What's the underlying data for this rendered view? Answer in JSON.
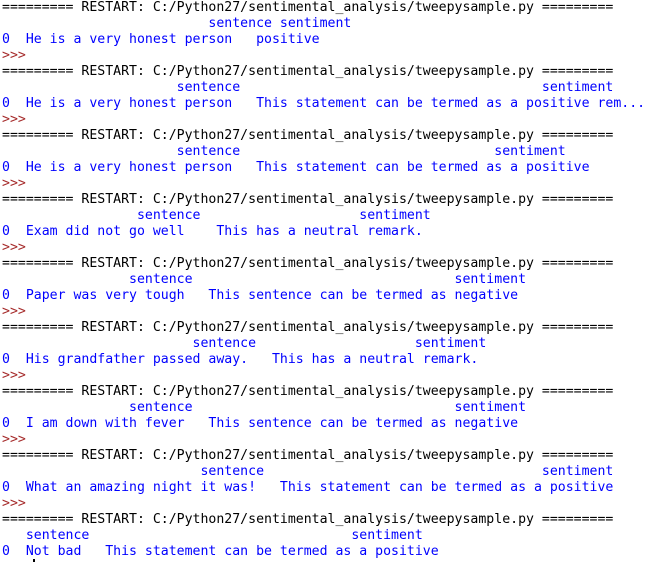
{
  "shell": {
    "colors": {
      "restart": "#000000",
      "output": "#0000ff",
      "prompt": "#a52a2a",
      "background": "#ffffff"
    },
    "lines": [
      {
        "kind": "restart",
        "text": "========= RESTART: C:/Python27/sentimental_analysis/tweepysample.py ========="
      },
      {
        "kind": "output",
        "text": "                          sentence sentiment"
      },
      {
        "kind": "output",
        "text": "0  He is a very honest person   positive"
      },
      {
        "kind": "prompt",
        "text": ">>>"
      },
      {
        "kind": "restart",
        "text": "========= RESTART: C:/Python27/sentimental_analysis/tweepysample.py ========="
      },
      {
        "kind": "output",
        "text": "                      sentence                                      sentiment"
      },
      {
        "kind": "output",
        "text": "0  He is a very honest person   This statement can be termed as a positive rem..."
      },
      {
        "kind": "prompt",
        "text": ">>>"
      },
      {
        "kind": "restart",
        "text": "========= RESTART: C:/Python27/sentimental_analysis/tweepysample.py ========="
      },
      {
        "kind": "output",
        "text": "                      sentence                                sentiment"
      },
      {
        "kind": "output",
        "text": "0  He is a very honest person   This statement can be termed as a positive"
      },
      {
        "kind": "prompt",
        "text": ">>>"
      },
      {
        "kind": "restart",
        "text": "========= RESTART: C:/Python27/sentimental_analysis/tweepysample.py ========="
      },
      {
        "kind": "output",
        "text": "                 sentence                    sentiment"
      },
      {
        "kind": "output",
        "text": "0  Exam did not go well    This has a neutral remark."
      },
      {
        "kind": "prompt",
        "text": ">>>"
      },
      {
        "kind": "restart",
        "text": "========= RESTART: C:/Python27/sentimental_analysis/tweepysample.py ========="
      },
      {
        "kind": "output",
        "text": "                sentence                                 sentiment"
      },
      {
        "kind": "output",
        "text": "0  Paper was very tough   This sentence can be termed as negative"
      },
      {
        "kind": "prompt",
        "text": ">>>"
      },
      {
        "kind": "restart",
        "text": "========= RESTART: C:/Python27/sentimental_analysis/tweepysample.py ========="
      },
      {
        "kind": "output",
        "text": "                        sentence                    sentiment"
      },
      {
        "kind": "output",
        "text": "0  His grandfather passed away.   This has a neutral remark."
      },
      {
        "kind": "prompt",
        "text": ">>>"
      },
      {
        "kind": "restart",
        "text": "========= RESTART: C:/Python27/sentimental_analysis/tweepysample.py ========="
      },
      {
        "kind": "output",
        "text": "                sentence                                 sentiment"
      },
      {
        "kind": "output",
        "text": "0  I am down with fever   This sentence can be termed as negative"
      },
      {
        "kind": "prompt",
        "text": ">>>"
      },
      {
        "kind": "restart",
        "text": "========= RESTART: C:/Python27/sentimental_analysis/tweepysample.py ========="
      },
      {
        "kind": "output",
        "text": "                         sentence                                   sentiment"
      },
      {
        "kind": "output",
        "text": "0  What an amazing night it was!   This statement can be termed as a positive"
      },
      {
        "kind": "prompt",
        "text": ">>>"
      },
      {
        "kind": "restart",
        "text": "========= RESTART: C:/Python27/sentimental_analysis/tweepysample.py ========="
      },
      {
        "kind": "output",
        "text": "   sentence                                 sentiment"
      },
      {
        "kind": "output",
        "text": "0  Not bad   This statement can be termed as a positive"
      }
    ]
  }
}
